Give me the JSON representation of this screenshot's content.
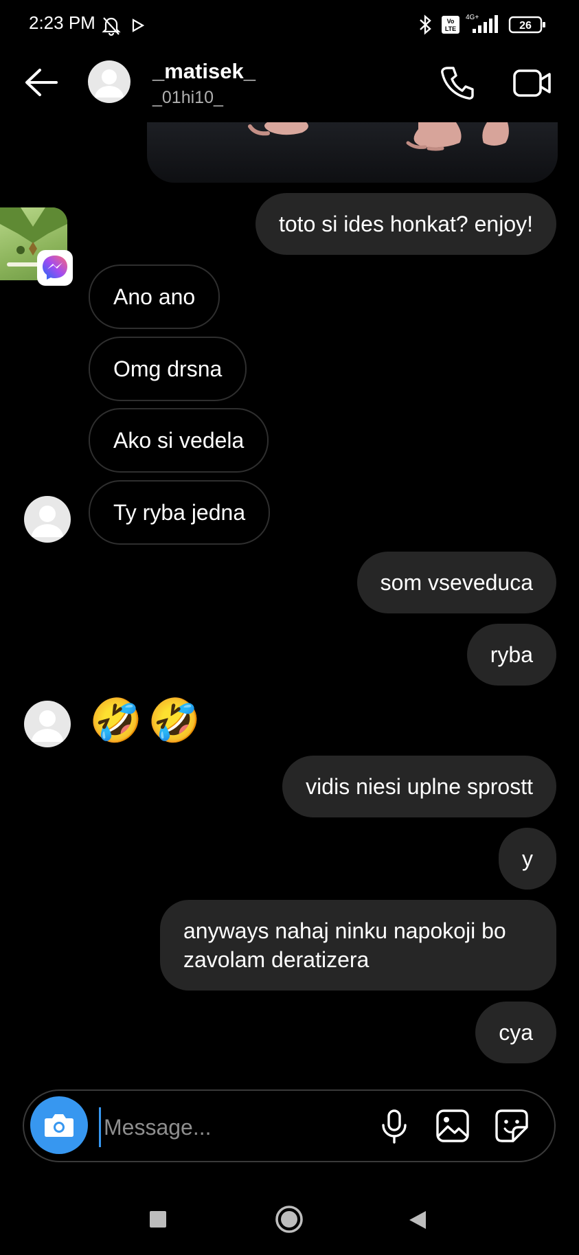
{
  "status_bar": {
    "time": "2:23 PM",
    "battery": "26",
    "network": "4G+",
    "icons": [
      "mute-bell-icon",
      "play-store-notification-icon",
      "bluetooth-icon",
      "volte-icon",
      "signal-icon",
      "battery-icon"
    ]
  },
  "header": {
    "name": "_matisek_",
    "username": "_01hi10_",
    "icons": [
      "back-arrow-icon",
      "phone-icon",
      "video-call-icon"
    ]
  },
  "messages": [
    {
      "side": "out",
      "text": "toto si ides honkat? enjoy!"
    },
    {
      "side": "in",
      "text": "Ano ano"
    },
    {
      "side": "in",
      "text": "Omg drsna"
    },
    {
      "side": "in",
      "text": "Ako si vedela"
    },
    {
      "side": "in",
      "text": "Ty ryba jedna"
    },
    {
      "side": "out",
      "text": "som vseveduca"
    },
    {
      "side": "out",
      "text": "ryba"
    },
    {
      "side": "in",
      "text": "🤣🤣"
    },
    {
      "side": "out",
      "text": "vidis niesi uplne sprostt"
    },
    {
      "side": "out",
      "text": "y"
    },
    {
      "side": "out",
      "text": "anyways nahaj ninku napokoji bo zavolam deratizera"
    },
    {
      "side": "out",
      "text": "cya"
    }
  ],
  "composer": {
    "placeholder": "Message...",
    "icons": [
      "camera-icon",
      "microphone-icon",
      "gallery-icon",
      "sticker-icon"
    ]
  },
  "colors": {
    "background": "#000000",
    "outgoing_bubble": "#262626",
    "incoming_border": "#2f2f2f",
    "accent": "#3797f0"
  }
}
